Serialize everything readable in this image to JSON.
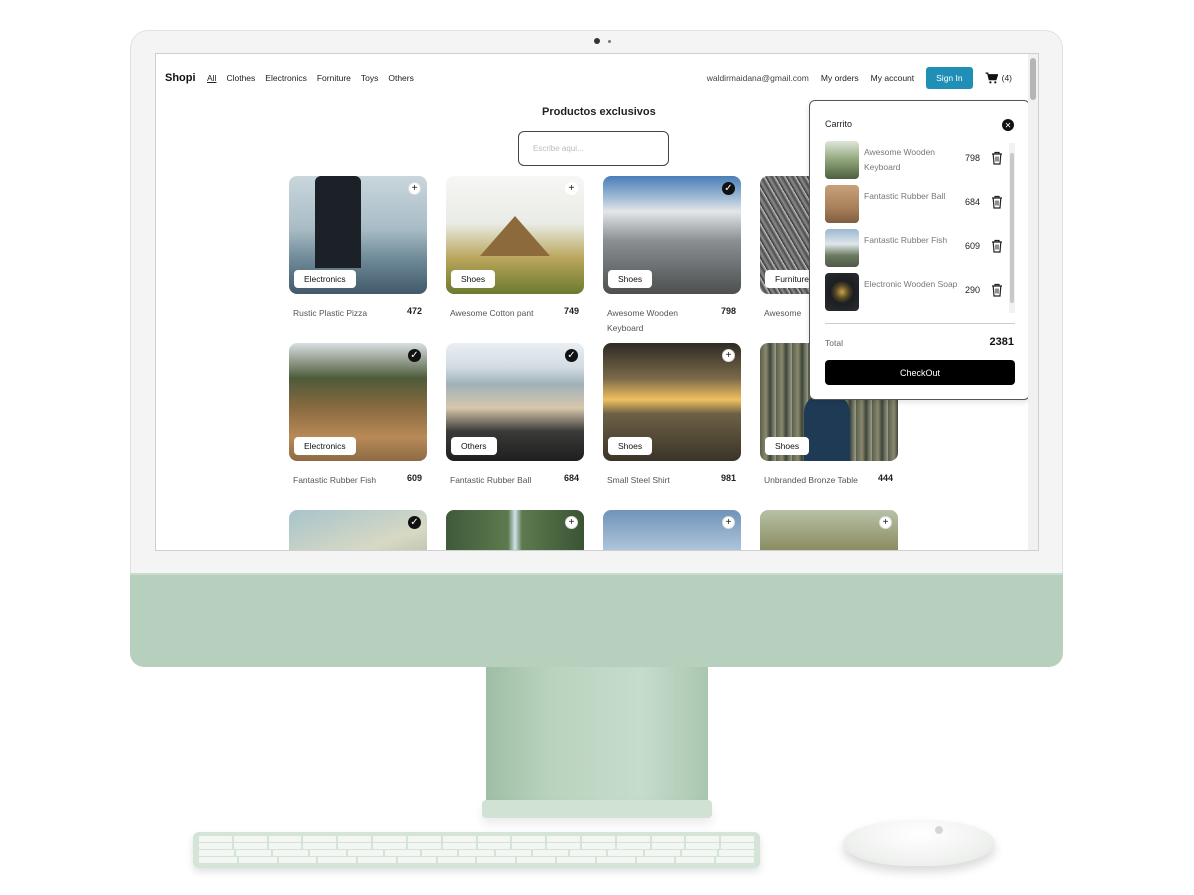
{
  "nav": {
    "brand": "Shopi",
    "links": [
      "All",
      "Clothes",
      "Electronics",
      "Forniture",
      "Toys",
      "Others"
    ],
    "email": "waldirmaidana@gmail.com",
    "my_orders": "My orders",
    "my_account": "My account",
    "signin": "Sign In",
    "cart_count": "(4)"
  },
  "main": {
    "title": "Productos exclusivos",
    "search_placeholder": "Escribe aqui..."
  },
  "products": [
    {
      "name": "Rustic Plastic Pizza",
      "price": "472",
      "category": "Electronics",
      "status": "add"
    },
    {
      "name": "Awesome Cotton pant",
      "price": "749",
      "category": "Shoes",
      "status": "add"
    },
    {
      "name": "Awesome Wooden Keyboard",
      "price": "798",
      "category": "Shoes",
      "status": "checked"
    },
    {
      "name": "Awesome",
      "price": "",
      "category": "Furniture",
      "status": "checked"
    },
    {
      "name": "Fantastic Rubber Fish",
      "price": "609",
      "category": "Electronics",
      "status": "checked"
    },
    {
      "name": "Fantastic Rubber Ball",
      "price": "684",
      "category": "Others",
      "status": "checked"
    },
    {
      "name": "Small Steel Shirt",
      "price": "981",
      "category": "Shoes",
      "status": "add"
    },
    {
      "name": "Unbranded Bronze Table",
      "price": "444",
      "category": "Shoes",
      "status": "add"
    },
    {
      "name": "",
      "price": "",
      "category": "",
      "status": "checked"
    },
    {
      "name": "",
      "price": "",
      "category": "",
      "status": "add"
    },
    {
      "name": "",
      "price": "",
      "category": "",
      "status": "add"
    },
    {
      "name": "",
      "price": "",
      "category": "",
      "status": "add"
    }
  ],
  "cart": {
    "title": "Carrito",
    "items": [
      {
        "name": "Awesome Wooden Keyboard",
        "price": "798"
      },
      {
        "name": "Fantastic Rubber Ball",
        "price": "684"
      },
      {
        "name": "Fantastic Rubber Fish",
        "price": "609"
      },
      {
        "name": "Electronic Wooden Soap",
        "price": "290"
      }
    ],
    "total_label": "Total",
    "total_value": "2381",
    "checkout_label": "CheckOut"
  },
  "colors": {
    "signin_bg": "#1f8fb5",
    "imac_chin": "#b7cfbd"
  },
  "icons": {
    "cart": "cart-icon",
    "close": "close-icon",
    "trash": "trash-icon",
    "add": "plus-icon",
    "checked": "check-icon"
  }
}
